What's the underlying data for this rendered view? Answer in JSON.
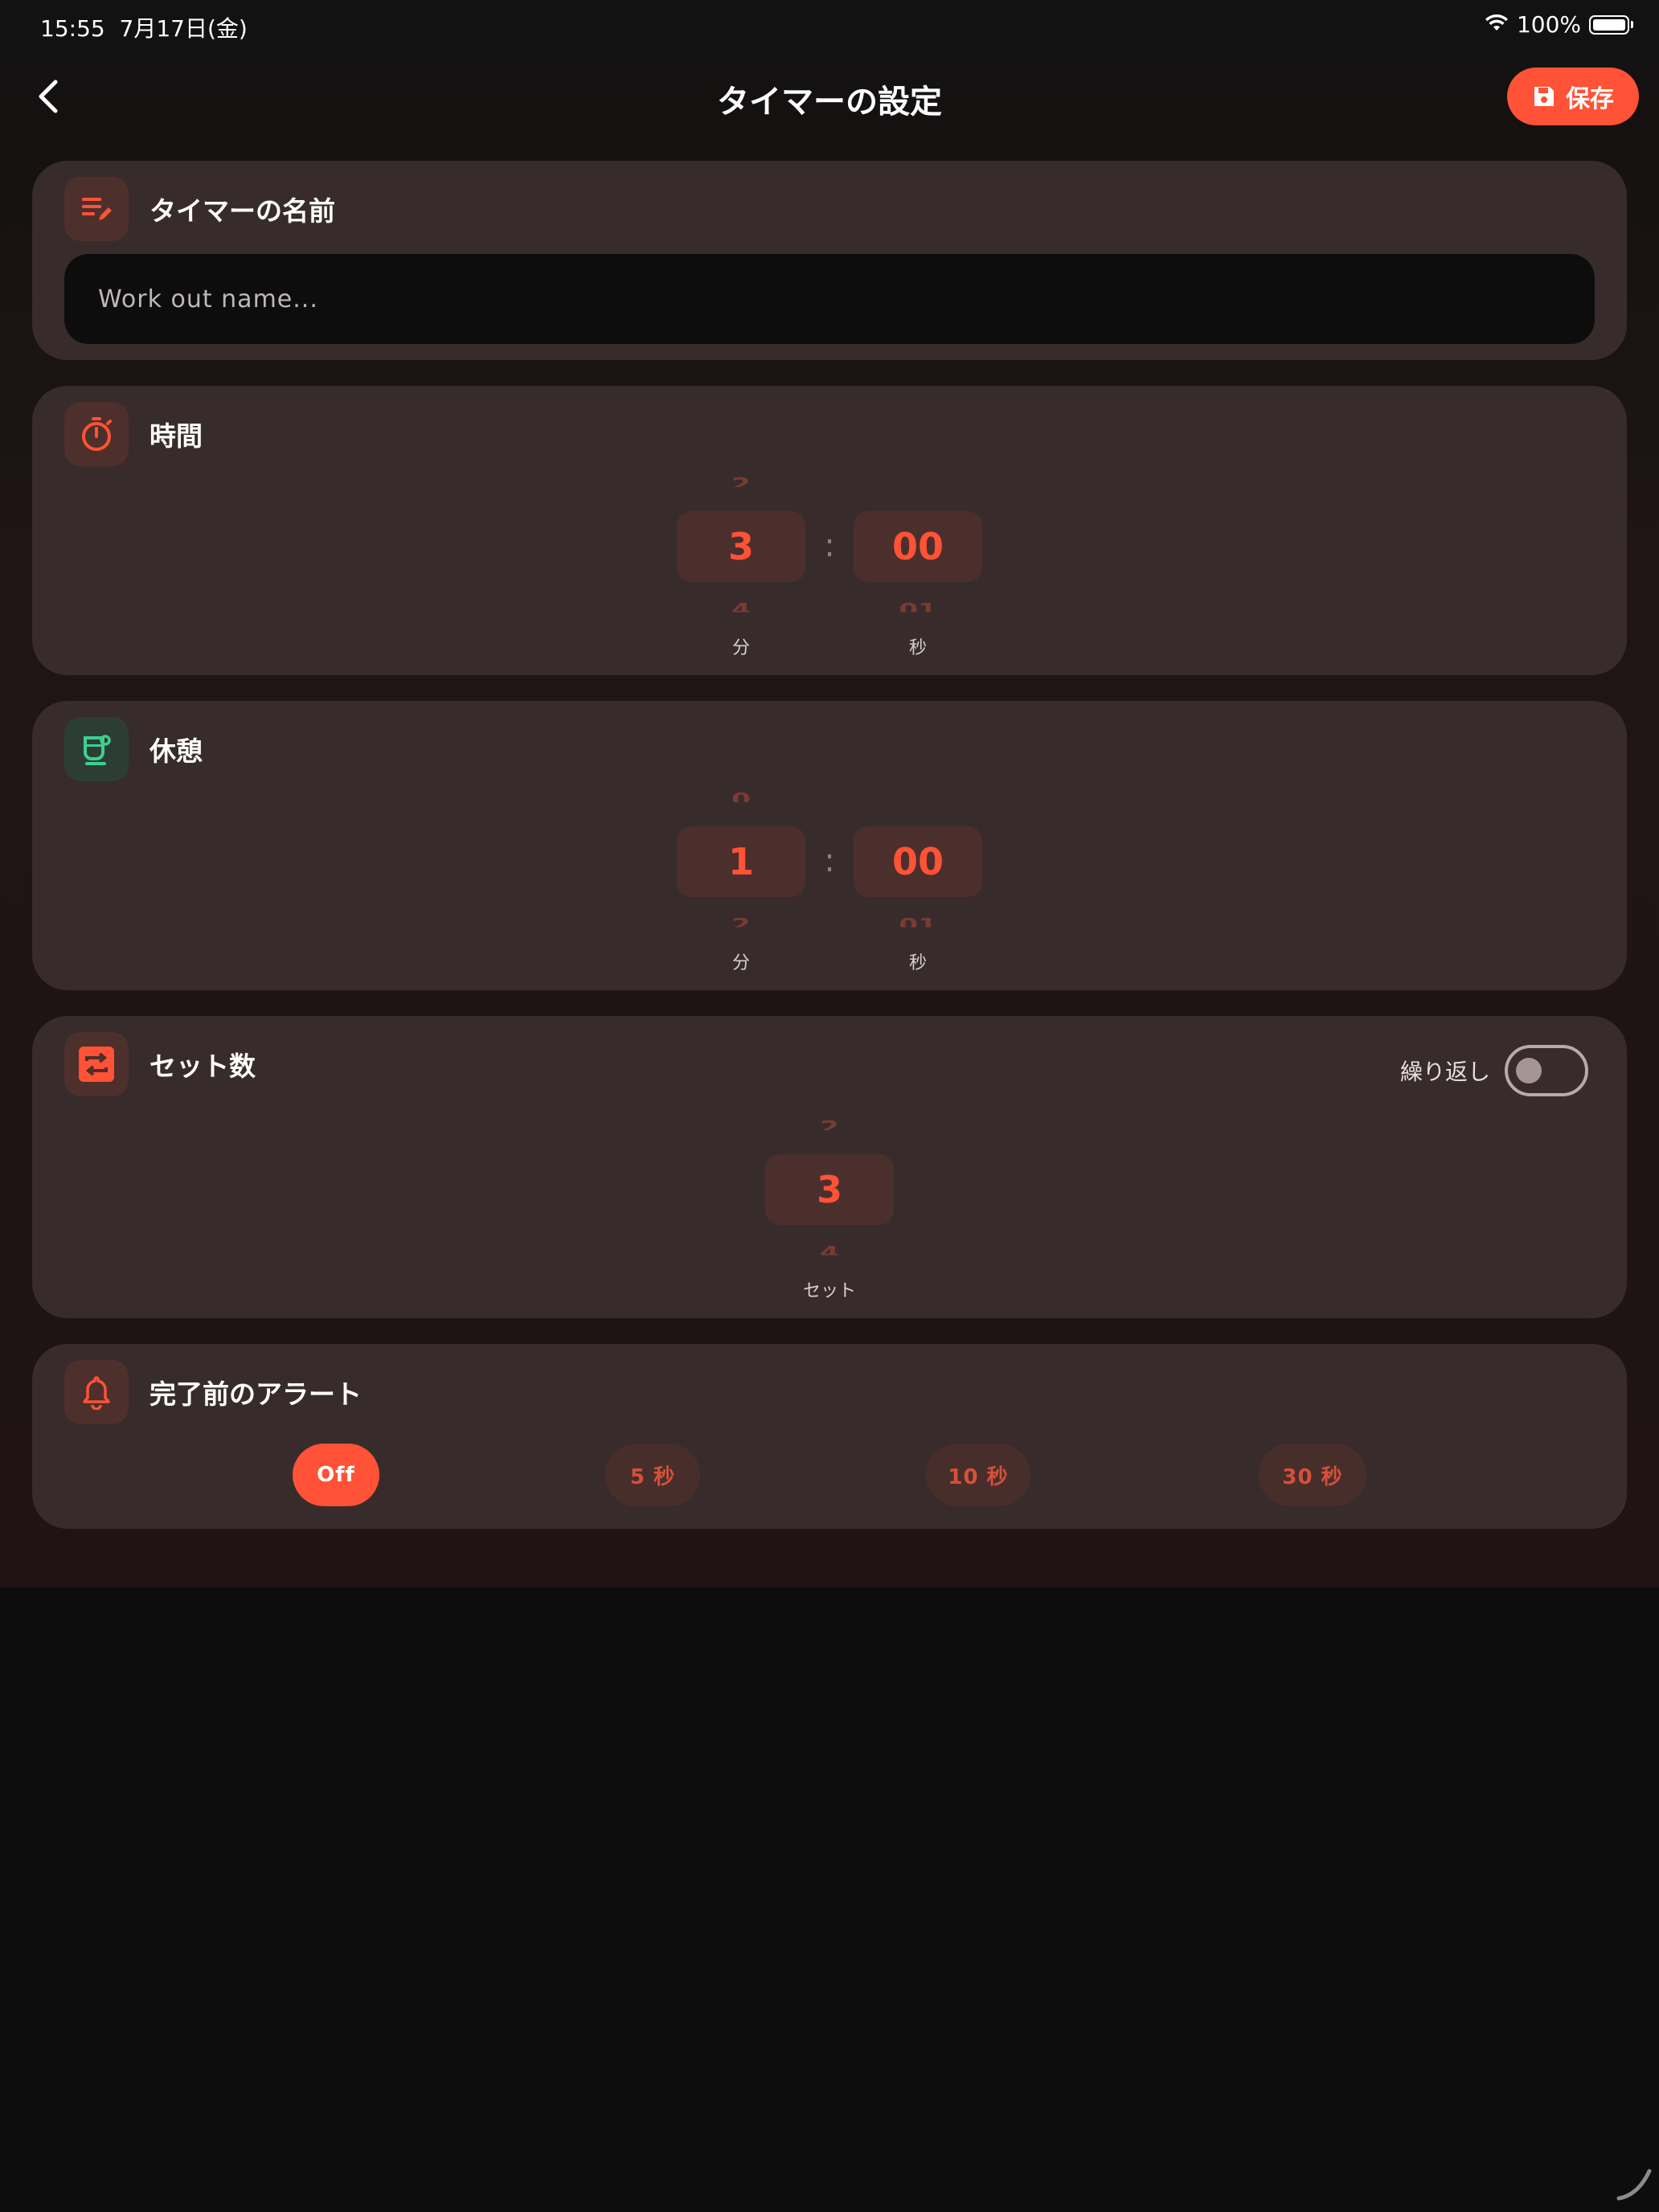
{
  "status_bar": {
    "time": "15:55",
    "date": "7月17日(金)",
    "battery": "100%"
  },
  "nav": {
    "title": "タイマーの設定",
    "save_label": "保存"
  },
  "name_card": {
    "title": "タイマーの名前",
    "placeholder": "Work out name..."
  },
  "duration_card": {
    "title": "時間",
    "minutes": {
      "prev": "2",
      "value": "3",
      "next": "4",
      "unit": "分"
    },
    "seconds": {
      "value": "00",
      "next": "01",
      "unit": "秒"
    },
    "separator": ":"
  },
  "rest_card": {
    "title": "休憩",
    "minutes": {
      "prev": "0",
      "value": "1",
      "next": "2",
      "unit": "分"
    },
    "seconds": {
      "value": "00",
      "next": "01",
      "unit": "秒"
    },
    "separator": ":"
  },
  "sets_card": {
    "title": "セット数",
    "repeat_label": "繰り返し",
    "repeat_on": false,
    "sets": {
      "prev": "2",
      "value": "3",
      "next": "4",
      "unit": "セット"
    }
  },
  "alert_card": {
    "title": "完了前のアラート",
    "options": [
      {
        "label": "Off",
        "selected": true
      },
      {
        "label": "5 秒",
        "selected": false
      },
      {
        "label": "10 秒",
        "selected": false
      },
      {
        "label": "30 秒",
        "selected": false
      }
    ]
  },
  "colors": {
    "accent": "#ff5236",
    "card": "#382b2b",
    "rest_accent": "#3ecf8e"
  }
}
